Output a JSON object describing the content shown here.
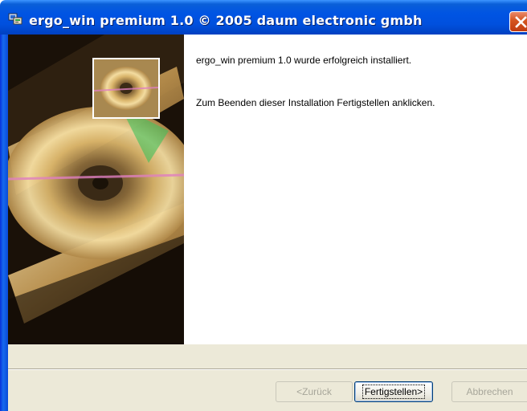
{
  "window": {
    "title": "ergo_win premium 1.0 © 2005 daum electronic gmbh",
    "icon": "installer-icon",
    "close_icon": "close-icon"
  },
  "content": {
    "message_installed": "ergo_win premium 1.0 wurde erfolgreich installiert.",
    "message_finish": "Zum Beenden dieser Installation Fertigstellen anklicken."
  },
  "buttons": {
    "back": {
      "label": "<Zurück",
      "enabled": false
    },
    "finish": {
      "label": "Fertigstellen>",
      "enabled": true,
      "default": true
    },
    "cancel": {
      "label": "Abbrechen",
      "enabled": false
    }
  },
  "colors": {
    "titlebar": "#0054e3",
    "close": "#d4541f",
    "dialog_bg": "#ece9d8",
    "disabled_text": "#a7a69a"
  }
}
